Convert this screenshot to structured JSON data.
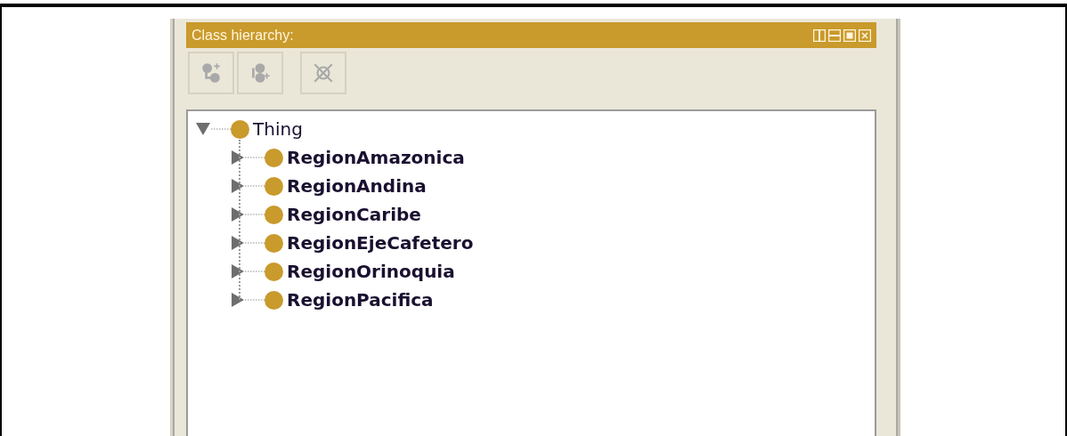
{
  "panel": {
    "title": "Class hierarchy:",
    "view_buttons": [
      {
        "kind": "split-vertical"
      },
      {
        "kind": "split-horizontal"
      },
      {
        "kind": "maximize"
      },
      {
        "kind": "close"
      }
    ]
  },
  "toolbar": [
    {
      "kind": "add-subclass",
      "disabled": true
    },
    {
      "kind": "add-sibling",
      "disabled": true
    },
    {
      "kind": "delete",
      "disabled": true
    }
  ],
  "tree": [
    {
      "label": "Thing",
      "bold": false,
      "expanded": true,
      "children": [
        {
          "label": "RegionAmazonica",
          "bold": true,
          "expanded": false
        },
        {
          "label": "RegionAndina",
          "bold": true,
          "expanded": false
        },
        {
          "label": "RegionCaribe",
          "bold": true,
          "expanded": false
        },
        {
          "label": "RegionEjeCafetero",
          "bold": true,
          "expanded": false
        },
        {
          "label": "RegionOrinoquia",
          "bold": true,
          "expanded": false
        },
        {
          "label": "RegionPacifica",
          "bold": true,
          "expanded": false
        }
      ]
    }
  ]
}
